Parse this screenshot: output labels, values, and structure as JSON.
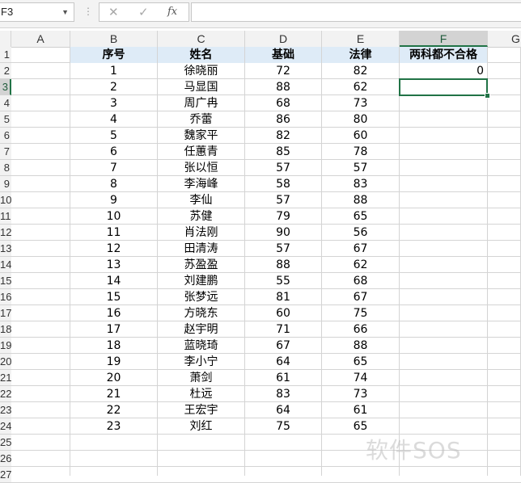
{
  "formula_bar": {
    "name_box": "F3",
    "cancel_glyph": "✕",
    "enter_glyph": "✓",
    "fx_label": "fx",
    "formula": ""
  },
  "columns": [
    "A",
    "B",
    "C",
    "D",
    "E",
    "F",
    "G"
  ],
  "rows": [
    "1",
    "2",
    "3",
    "4",
    "5",
    "6",
    "7",
    "8",
    "9",
    "10",
    "11",
    "12",
    "13",
    "14",
    "15",
    "16",
    "17",
    "18",
    "19",
    "20",
    "21",
    "22",
    "23",
    "24",
    "25",
    "26",
    "27"
  ],
  "headers": {
    "seq": "序号",
    "name": "姓名",
    "base": "基础",
    "law": "法律",
    "both_fail": "两科都不合格"
  },
  "records": [
    {
      "seq": "1",
      "name": "徐晓丽",
      "base": "72",
      "law": "82"
    },
    {
      "seq": "2",
      "name": "马显国",
      "base": "88",
      "law": "62"
    },
    {
      "seq": "3",
      "name": "周广冉",
      "base": "68",
      "law": "73"
    },
    {
      "seq": "4",
      "name": "乔蕾",
      "base": "86",
      "law": "80"
    },
    {
      "seq": "5",
      "name": "魏家平",
      "base": "82",
      "law": "60"
    },
    {
      "seq": "6",
      "name": "任蕙青",
      "base": "85",
      "law": "78"
    },
    {
      "seq": "7",
      "name": "张以恒",
      "base": "57",
      "law": "57"
    },
    {
      "seq": "8",
      "name": "李海峰",
      "base": "58",
      "law": "83"
    },
    {
      "seq": "9",
      "name": "李仙",
      "base": "57",
      "law": "88"
    },
    {
      "seq": "10",
      "name": "苏健",
      "base": "79",
      "law": "65"
    },
    {
      "seq": "11",
      "name": "肖法刚",
      "base": "90",
      "law": "56"
    },
    {
      "seq": "12",
      "name": "田清涛",
      "base": "57",
      "law": "67"
    },
    {
      "seq": "13",
      "name": "苏盈盈",
      "base": "88",
      "law": "62"
    },
    {
      "seq": "14",
      "name": "刘建鹏",
      "base": "55",
      "law": "68"
    },
    {
      "seq": "15",
      "name": "张梦远",
      "base": "81",
      "law": "67"
    },
    {
      "seq": "16",
      "name": "方晓东",
      "base": "60",
      "law": "75"
    },
    {
      "seq": "17",
      "name": "赵宇明",
      "base": "71",
      "law": "66"
    },
    {
      "seq": "18",
      "name": "蓝晓琦",
      "base": "67",
      "law": "88"
    },
    {
      "seq": "19",
      "name": "李小宁",
      "base": "64",
      "law": "65"
    },
    {
      "seq": "20",
      "name": "萧剑",
      "base": "61",
      "law": "74"
    },
    {
      "seq": "21",
      "name": "杜远",
      "base": "83",
      "law": "73"
    },
    {
      "seq": "22",
      "name": "王宏宇",
      "base": "64",
      "law": "61"
    },
    {
      "seq": "23",
      "name": "刘红",
      "base": "75",
      "law": "65"
    }
  ],
  "result_value": "0",
  "watermark": "软件SOS",
  "colors": {
    "selection": "#217346",
    "header_fill": "#deebf7",
    "grid": "#d4d4d4"
  }
}
